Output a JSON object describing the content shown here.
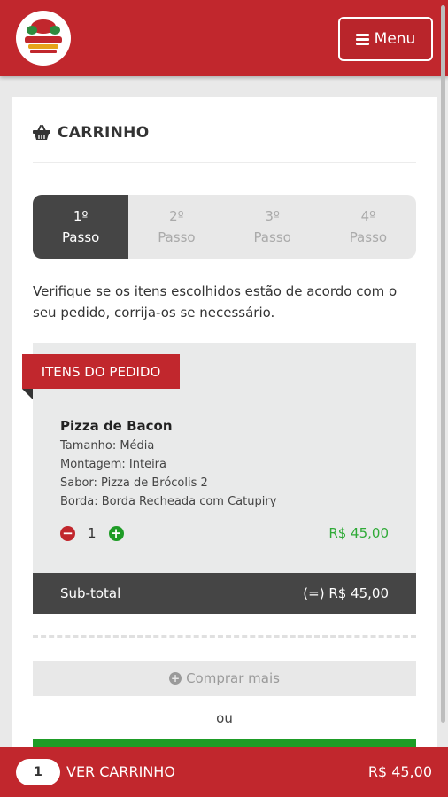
{
  "header": {
    "logo_alt": "Logo da pizzaria",
    "menu_label": "Menu"
  },
  "cart": {
    "title": "CARRINHO",
    "steps": [
      {
        "num": "1º",
        "label": "Passo",
        "active": true
      },
      {
        "num": "2º",
        "label": "Passo",
        "active": false
      },
      {
        "num": "3º",
        "label": "Passo",
        "active": false
      },
      {
        "num": "4º",
        "label": "Passo",
        "active": false
      }
    ],
    "intro": "Verifique se os itens escolhidos estão de acordo com o seu pedido, corrija-os se necessário.",
    "section_label": "ITENS DO PEDIDO",
    "item": {
      "name": "Pizza de Bacon",
      "size": "Tamanho: Média",
      "assembly": "Montagem: Inteira",
      "flavor": "Sabor: Pizza de Brócolis 2",
      "crust": "Borda: Borda Recheada com Catupiry",
      "quantity": "1",
      "price": "R$ 45,00"
    },
    "subtotal_label": "Sub-total",
    "subtotal_value": "(=) R$ 45,00",
    "buy_more": "Comprar mais",
    "or": "ou"
  },
  "bottom_bar": {
    "count": "1",
    "label": "VER CARRINHO",
    "total": "R$ 45,00"
  },
  "colors": {
    "brand_red": "#c1272d",
    "dark": "#454545",
    "green": "#1e9c26"
  }
}
